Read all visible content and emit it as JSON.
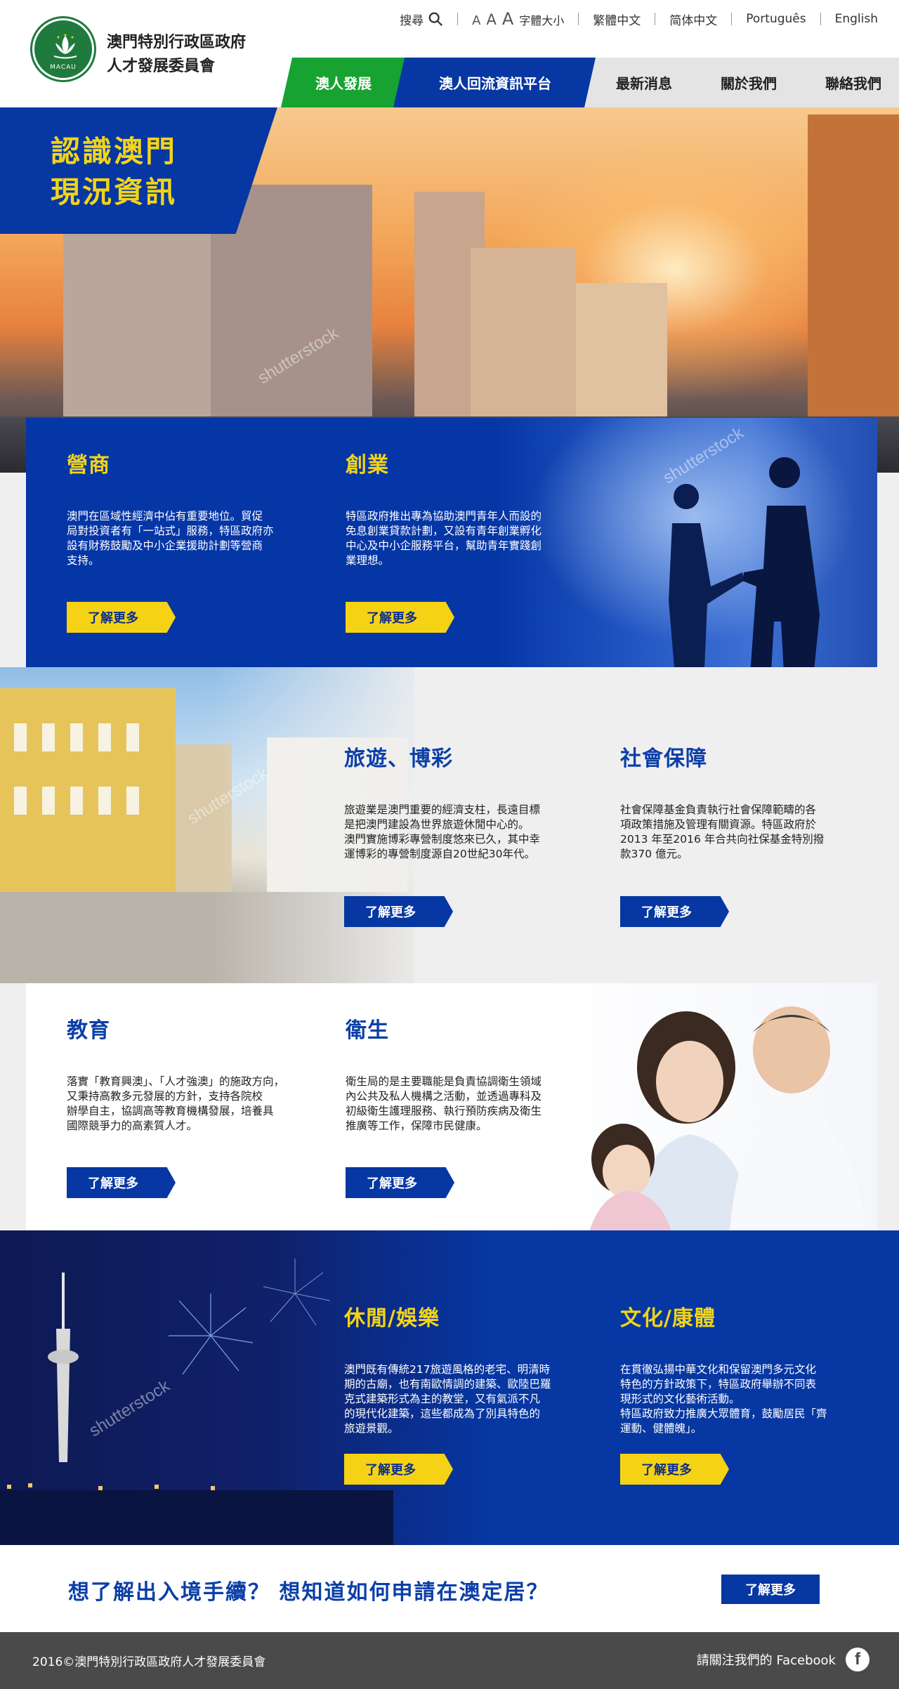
{
  "header": {
    "org_name_line1": "澳門特別行政區政府",
    "org_name_line2": "人才發展委員會",
    "logo_text": "MACAU",
    "search_label": "搜尋",
    "font_size_a": "A",
    "font_size_label": "字體大小",
    "lang_tc": "繁體中文",
    "lang_sc": "简体中文",
    "lang_pt": "Português",
    "lang_en": "English"
  },
  "nav": {
    "item1": "澳人發展",
    "item2": "澳人回流資訊平台",
    "item3": "最新消息",
    "item4": "關於我們",
    "item5": "聯絡我們"
  },
  "hero": {
    "title_line1": "認識澳門",
    "title_line2": "現況資訊"
  },
  "sections": {
    "business": {
      "title": "營商",
      "text": "澳門在區域性經濟中佔有重要地位。貿促\n局對投資者有「一站式」服務，特區政府亦\n設有財務鼓勵及中小企業援助計劃等營商\n支持。",
      "button": "了解更多"
    },
    "startup": {
      "title": "創業",
      "text": "特區政府推出專為協助澳門青年人而設的\n免息創業貸款計劃，又設有青年創業孵化\n中心及中小企服務平台，幫助青年實踐創\n業理想。",
      "button": "了解更多"
    },
    "tourism": {
      "title": "旅遊、博彩",
      "text": "旅遊業是澳門重要的經濟支柱，長遠目標\n是把澳門建設為世界旅遊休閒中心的。\n澳門實施博彩專營制度悠來已久，其中幸\n運博彩的專營制度源自20世紀30年代。",
      "button": "了解更多"
    },
    "social": {
      "title": "社會保障",
      "text": "社會保障基金負責執行社會保障範疇的各\n項政策措施及管理有關資源。特區政府於\n2013 年至2016 年合共向社保基金特別撥\n款370 億元。",
      "button": "了解更多"
    },
    "education": {
      "title": "教育",
      "text": "落實「教育興澳」、「人才強澳」的施政方向，\n又秉持高教多元發展的方針，支持各院校\n辦學自主，協調高等教育機構發展，培養具\n國際競爭力的高素質人才。",
      "button": "了解更多"
    },
    "health": {
      "title": "衛生",
      "text": "衛生局的是主要職能是負責協調衛生領域\n內公共及私人機構之活動，並透過專科及\n初級衛生護理服務、執行預防疾病及衛生\n推廣等工作，保障市民健康。",
      "button": "了解更多"
    },
    "leisure": {
      "title": "休閒/娛樂",
      "text": "澳門既有傳統217旅遊風格的老宅、明清時\n期的古廟，也有南歐情調的建築、歐陸巴羅\n克式建築形式為主的教堂，又有氣派不凡\n的現代化建築，這些都成為了別具特色的\n旅遊景觀。",
      "button": "了解更多"
    },
    "culture": {
      "title": "文化/康體",
      "text": "在貫徹弘揚中華文化和保留澳門多元文化\n特色的方針政策下，特區政府舉辦不同表\n現形式的文化藝術活動。\n特區政府致力推廣大眾體育，鼓勵居民「齊\n運動、健體魄」。",
      "button": "了解更多"
    }
  },
  "band": {
    "text": "想了解出入境手續？ 想知道如何申請在澳定居？",
    "button": "了解更多"
  },
  "footer": {
    "copyright": "2016©澳門特別行政區政府人才發展委員會",
    "facebook_text": "請關注我們的 Facebook",
    "facebook_icon": "f"
  },
  "watermark": "shutterstock",
  "colors": {
    "brand_blue": "#0637a3",
    "accent_yellow": "#f6d214",
    "nav_green": "#17a332",
    "nav_gray": "#e4e4e4",
    "footer_gray": "#4a4a4a"
  }
}
